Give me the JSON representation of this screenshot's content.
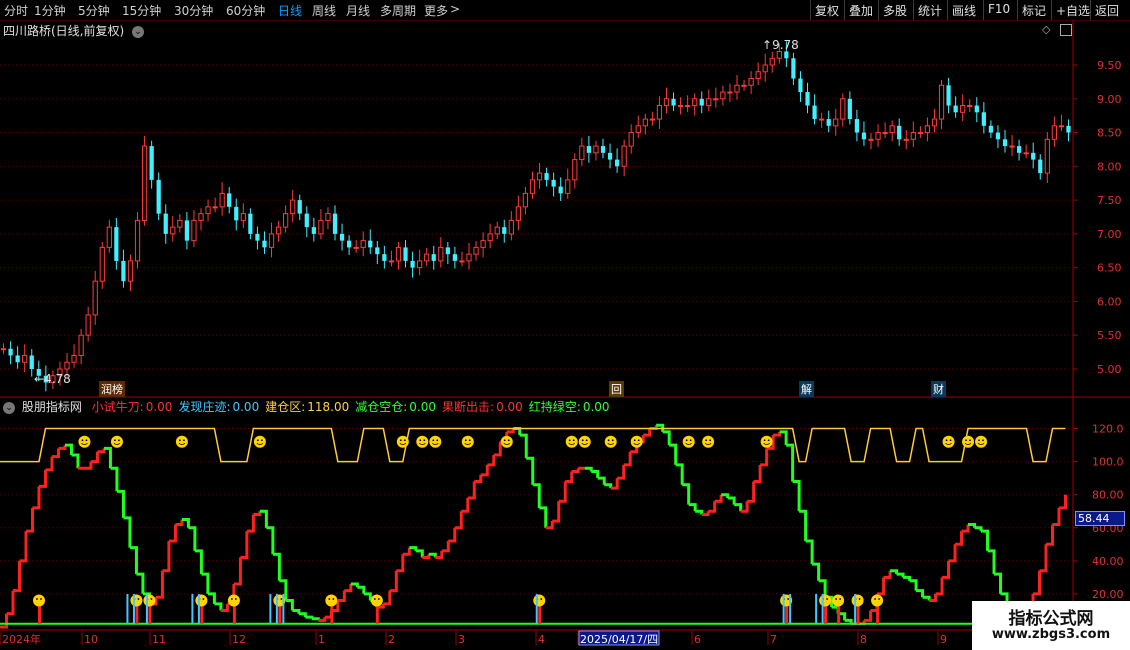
{
  "toolbar": {
    "left": [
      "分时",
      "1分钟",
      "5分钟",
      "15分钟",
      "30分钟",
      "60分钟",
      "日线",
      "周线",
      "月线",
      "多周期",
      "更多"
    ],
    "more_arrow": ">",
    "right": [
      "复权",
      "叠加",
      "多股",
      "统计",
      "画线",
      "F10",
      "标记",
      "+自选",
      "返回"
    ]
  },
  "price_pane": {
    "title": "四川路桥(日线,前复权)",
    "high_label": "9.78",
    "low_label": "4.78",
    "y_ticks": [
      "9.50",
      "9.00",
      "8.50",
      "8.00",
      "7.50",
      "7.00",
      "6.50",
      "6.00",
      "5.50",
      "5.00"
    ]
  },
  "event_markers": [
    "润榜",
    "回",
    "解",
    "财"
  ],
  "indicator_pane": {
    "name": "股朋指标网",
    "legend": [
      {
        "label": "小试牛刀:",
        "value": "0.00",
        "color": "#ff3030"
      },
      {
        "label": "发现庄迹:",
        "value": "0.00",
        "color": "#40c8ff"
      },
      {
        "label": "建仓区:",
        "value": "118.00",
        "color": "#ffd040"
      },
      {
        "label": "减仓空仓:",
        "value": "0.00",
        "color": "#30ff30"
      },
      {
        "label": "果断出击:",
        "value": "0.00",
        "color": "#ff3030"
      },
      {
        "label": "红持绿空:",
        "value": "0.00",
        "color": "#30ff30"
      }
    ],
    "y_ticks": [
      "120.0",
      "100.0",
      "80.00",
      "60.00",
      "40.00",
      "20.00"
    ],
    "current_value": "58.44"
  },
  "time_axis": {
    "labels": [
      "2024年",
      "10",
      "11",
      "12",
      "1",
      "2",
      "3",
      "4",
      "2025/04/17/四",
      "6",
      "7",
      "8",
      "9"
    ]
  },
  "watermark": {
    "title": "指标公式网",
    "url": "www.zbgs3.com"
  },
  "colors": {
    "up": "#ff3a3a",
    "down": "#40f0ff",
    "grid": "#5a0000",
    "axis": "#a00000",
    "osc_up": "#ff2020",
    "osc_down": "#20ff20",
    "band": "#ffcc33"
  },
  "chart_data": [
    {
      "type": "candlestick",
      "series": [
        {
          "name": "四川路桥",
          "values": [
            5.3,
            5.2,
            5.1,
            5.2,
            5.0,
            4.9,
            4.8,
            4.9,
            5.0,
            5.1,
            5.2,
            5.5,
            5.8,
            6.3,
            6.8,
            7.1,
            6.6,
            6.3,
            6.6,
            7.2,
            8.3,
            7.8,
            7.3,
            7.0,
            7.1,
            7.2,
            6.9,
            7.2,
            7.3,
            7.4,
            7.4,
            7.6,
            7.4,
            7.2,
            7.3,
            7.0,
            6.9,
            6.8,
            7.0,
            7.1,
            7.3,
            7.5,
            7.3,
            7.1,
            7.0,
            7.2,
            7.3,
            7.0,
            6.9,
            6.8,
            6.8,
            6.9,
            6.8,
            6.7,
            6.6,
            6.6,
            6.8,
            6.6,
            6.5,
            6.6,
            6.7,
            6.6,
            6.8,
            6.7,
            6.6,
            6.6,
            6.7,
            6.8,
            6.9,
            7.0,
            7.1,
            7.0,
            7.2,
            7.4,
            7.6,
            7.8,
            7.9,
            7.8,
            7.7,
            7.6,
            7.8,
            8.1,
            8.3,
            8.2,
            8.3,
            8.2,
            8.1,
            8.0,
            8.3,
            8.5,
            8.6,
            8.7,
            8.7,
            8.9,
            9.0,
            8.9,
            8.9,
            8.9,
            9.0,
            8.9,
            9.0,
            9.0,
            9.1,
            9.1,
            9.2,
            9.2,
            9.3,
            9.4,
            9.5,
            9.6,
            9.7,
            9.6,
            9.3,
            9.1,
            8.9,
            8.7,
            8.7,
            8.6,
            8.7,
            9.0,
            8.7,
            8.5,
            8.4,
            8.4,
            8.5,
            8.5,
            8.6,
            8.4,
            8.4,
            8.5,
            8.5,
            8.6,
            8.7,
            9.2,
            8.9,
            8.8,
            8.9,
            8.9,
            8.8,
            8.6,
            8.5,
            8.4,
            8.3,
            8.3,
            8.2,
            8.2,
            8.1,
            7.9,
            8.4,
            8.6,
            8.6,
            8.5
          ]
        }
      ],
      "ylim": [
        4.6,
        9.9
      ]
    },
    {
      "type": "line",
      "series": [
        {
          "name": "红持绿空",
          "values": [
            0,
            8,
            22,
            40,
            58,
            72,
            85,
            95,
            103,
            108,
            110,
            104,
            96,
            96,
            100,
            106,
            108,
            96,
            82,
            66,
            48,
            32,
            20,
            14,
            18,
            34,
            52,
            62,
            65,
            60,
            46,
            32,
            20,
            14,
            10,
            14,
            26,
            42,
            58,
            68,
            70,
            60,
            44,
            28,
            16,
            10,
            8,
            6,
            5,
            4,
            6,
            10,
            16,
            22,
            26,
            24,
            20,
            16,
            12,
            14,
            22,
            34,
            44,
            48,
            46,
            42,
            44,
            42,
            46,
            52,
            60,
            70,
            78,
            88,
            92,
            98,
            104,
            112,
            118,
            120,
            116,
            102,
            86,
            72,
            60,
            64,
            76,
            88,
            94,
            96,
            96,
            94,
            90,
            86,
            84,
            90,
            98,
            106,
            112,
            116,
            120,
            122,
            118,
            110,
            98,
            86,
            74,
            70,
            68,
            70,
            76,
            80,
            78,
            74,
            70,
            76,
            88,
            98,
            108,
            116,
            118,
            110,
            88,
            70,
            52,
            38,
            28,
            18,
            12,
            8,
            4,
            2,
            2,
            4,
            10,
            20,
            30,
            34,
            32,
            30,
            28,
            22,
            18,
            16,
            20,
            30,
            40,
            50,
            58,
            62,
            60,
            58,
            46,
            32,
            20,
            12,
            8,
            6,
            8,
            20,
            34,
            50,
            62,
            72,
            80
          ]
        }
      ],
      "ylim": [
        0,
        130
      ]
    }
  ]
}
